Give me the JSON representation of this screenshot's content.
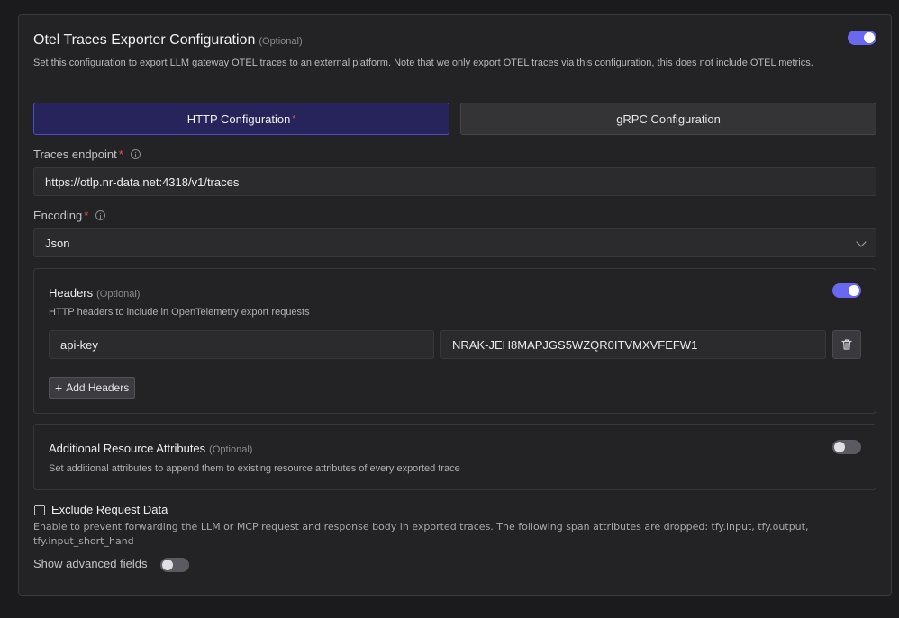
{
  "section": {
    "title": "Otel Traces Exporter Configuration",
    "optional_tag": "(Optional)",
    "enabled": true,
    "description": "Set this configuration to export LLM gateway OTEL traces to an external platform. Note that we only export OTEL traces via this configuration, this does not include OTEL metrics."
  },
  "tabs": [
    {
      "label": "HTTP Configuration",
      "required_mark": "*",
      "active": true
    },
    {
      "label": "gRPC Configuration",
      "active": false
    }
  ],
  "traces_endpoint": {
    "label": "Traces endpoint",
    "required_mark": "*",
    "value": "https://otlp.nr-data.net:4318/v1/traces"
  },
  "encoding": {
    "label": "Encoding",
    "required_mark": "*",
    "value": "Json"
  },
  "headers": {
    "title": "Headers",
    "optional_tag": "(Optional)",
    "enabled": true,
    "description": "HTTP headers to include in OpenTelemetry export requests",
    "rows": [
      {
        "key": "api-key",
        "value": "NRAK-JEH8MAPJGS5WZQR0ITVMXVFEFW1"
      }
    ],
    "add_label": "Add Headers"
  },
  "resource_attributes": {
    "title": "Additional Resource Attributes",
    "optional_tag": "(Optional)",
    "enabled": false,
    "description": "Set additional attributes to append them to existing resource attributes of every exported trace"
  },
  "exclude_request": {
    "label": "Exclude Request Data",
    "checked": false,
    "description": "Enable to prevent forwarding the LLM or MCP request and response body in exported traces. The following span attributes are dropped: tfy.input, tfy.output, tfy.input_short_hand"
  },
  "advanced": {
    "label": "Show advanced fields",
    "enabled": false
  },
  "colors": {
    "accent": "#6b68f0",
    "required": "#e25555",
    "background": "#1b1b1e",
    "panel": "#232326"
  },
  "icons": {
    "info": "info-icon",
    "chevron": "chevron-down-icon",
    "delete": "trash-icon",
    "add": "plus-icon"
  }
}
